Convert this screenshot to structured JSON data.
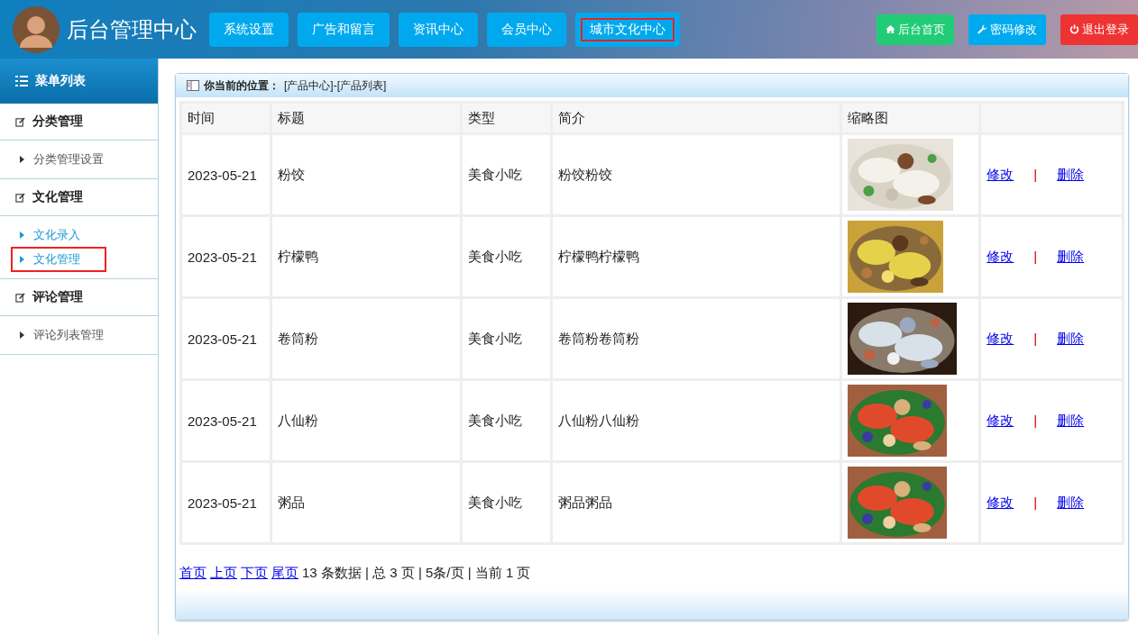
{
  "header": {
    "title": "后台管理中心",
    "nav": [
      {
        "label": "系统设置",
        "highlighted": false
      },
      {
        "label": "广告和留言",
        "highlighted": false
      },
      {
        "label": "资讯中心",
        "highlighted": false
      },
      {
        "label": "会员中心",
        "highlighted": false
      },
      {
        "label": "城市文化中心",
        "highlighted": true
      }
    ],
    "actions": [
      {
        "label": "后台首页",
        "kind": "home",
        "color": "#22cc77"
      },
      {
        "label": "密码修改",
        "kind": "wrench",
        "color": "#00aaee"
      },
      {
        "label": "退出登录",
        "kind": "power",
        "color": "#ee3333"
      }
    ]
  },
  "sidebar": {
    "title": "菜单列表",
    "groups": [
      {
        "label": "分类管理",
        "children": [
          {
            "label": "分类管理设置",
            "current": false,
            "highlighted": false
          }
        ]
      },
      {
        "label": "文化管理",
        "children": [
          {
            "label": "文化录入",
            "current": true,
            "highlighted": false
          },
          {
            "label": "文化管理",
            "current": true,
            "highlighted": true
          }
        ]
      },
      {
        "label": "评论管理",
        "children": [
          {
            "label": "评论列表管理",
            "current": false,
            "highlighted": false
          }
        ]
      }
    ]
  },
  "breadcrumb": {
    "label": "你当前的位置：",
    "path": "[产品中心]-[产品列表]"
  },
  "table": {
    "columns": [
      "时间",
      "标题",
      "类型",
      "简介",
      "缩略图"
    ],
    "rows": [
      {
        "time": "2023-05-21",
        "title": "粉饺",
        "type": "美食小吃",
        "summary": "粉饺粉饺",
        "edit": "修改",
        "separator": "|",
        "delete": "删除"
      },
      {
        "time": "2023-05-21",
        "title": "柠檬鸭",
        "type": "美食小吃",
        "summary": "柠檬鸭柠檬鸭",
        "edit": "修改",
        "separator": "|",
        "delete": "删除"
      },
      {
        "time": "2023-05-21",
        "title": "卷筒粉",
        "type": "美食小吃",
        "summary": "卷筒粉卷筒粉",
        "edit": "修改",
        "separator": "|",
        "delete": "删除"
      },
      {
        "time": "2023-05-21",
        "title": "八仙粉",
        "type": "美食小吃",
        "summary": "八仙粉八仙粉",
        "edit": "修改",
        "separator": "|",
        "delete": "删除"
      },
      {
        "time": "2023-05-21",
        "title": "粥品",
        "type": "美食小吃",
        "summary": "粥品粥品",
        "edit": "修改",
        "separator": "|",
        "delete": "删除"
      }
    ]
  },
  "pagination": {
    "links": [
      "首页",
      "上页",
      "下页",
      "尾页"
    ],
    "info": "13 条数据 | 总 3 页 | 5条/页 | 当前 1 页"
  }
}
